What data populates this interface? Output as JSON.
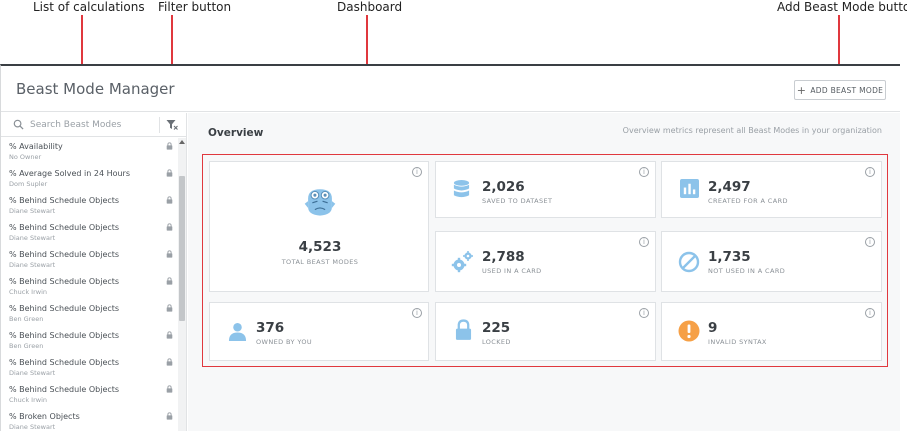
{
  "annotations": {
    "list_of_calculations": "List of calculations",
    "filter_button": "Filter button",
    "dashboard": "Dashboard",
    "add_beast_mode_button": "Add Beast Mode button"
  },
  "app": {
    "title": "Beast Mode Manager",
    "add_button_label": "ADD BEAST MODE"
  },
  "sidebar": {
    "search_placeholder": "Search Beast Modes",
    "items": [
      {
        "name": "% Availability",
        "owner": "No Owner"
      },
      {
        "name": "% Average Solved in 24 Hours",
        "owner": "Dom Supler"
      },
      {
        "name": "% Behind Schedule Objects",
        "owner": "Diane Stewart"
      },
      {
        "name": "% Behind Schedule Objects",
        "owner": "Diane Stewart"
      },
      {
        "name": "% Behind Schedule Objects",
        "owner": "Diane Stewart"
      },
      {
        "name": "% Behind Schedule Objects",
        "owner": "Chuck Irwin"
      },
      {
        "name": "% Behind Schedule Objects",
        "owner": "Ben Green"
      },
      {
        "name": "% Behind Schedule Objects",
        "owner": "Ben Green"
      },
      {
        "name": "% Behind Schedule Objects",
        "owner": "Diane Stewart"
      },
      {
        "name": "% Behind Schedule Objects",
        "owner": "Chuck Irwin"
      },
      {
        "name": "% Broken Objects",
        "owner": "Diane Stewart"
      }
    ]
  },
  "overview": {
    "title": "Overview",
    "subtitle": "Overview metrics represent all Beast Modes in your organization"
  },
  "metrics": {
    "total": {
      "value": "4,523",
      "label": "TOTAL BEAST MODES"
    },
    "saved_to_dataset": {
      "value": "2,026",
      "label": "SAVED TO DATASET"
    },
    "created_for_card": {
      "value": "2,497",
      "label": "CREATED FOR A CARD"
    },
    "used_in_card": {
      "value": "2,788",
      "label": "USED IN A CARD"
    },
    "not_used_in_card": {
      "value": "1,735",
      "label": "NOT USED IN A CARD"
    },
    "owned_by_you": {
      "value": "376",
      "label": "OWNED BY YOU"
    },
    "locked": {
      "value": "225",
      "label": "LOCKED"
    },
    "invalid_syntax": {
      "value": "9",
      "label": "INVALID SYNTAX"
    }
  },
  "colors": {
    "accent_blue": "#8cc3ea",
    "warning_orange": "#f6a046",
    "annotation_red": "#e0383e"
  }
}
